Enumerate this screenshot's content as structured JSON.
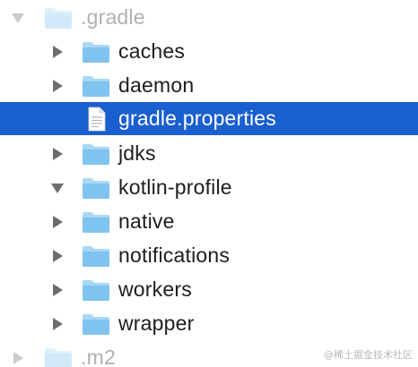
{
  "tree": {
    "items": [
      {
        "label": ".gradle",
        "type": "folder",
        "expanded": true,
        "faded": true
      },
      {
        "label": "caches",
        "type": "folder",
        "expanded": false
      },
      {
        "label": "daemon",
        "type": "folder",
        "expanded": false
      },
      {
        "label": "gradle.properties",
        "type": "file",
        "selected": true
      },
      {
        "label": "jdks",
        "type": "folder",
        "expanded": false
      },
      {
        "label": "kotlin-profile",
        "type": "folder",
        "expanded": true
      },
      {
        "label": "native",
        "type": "folder",
        "expanded": false
      },
      {
        "label": "notifications",
        "type": "folder",
        "expanded": false
      },
      {
        "label": "workers",
        "type": "folder",
        "expanded": false
      },
      {
        "label": "wrapper",
        "type": "folder",
        "expanded": false
      },
      {
        "label": ".m2",
        "type": "folder",
        "expanded": false,
        "faded": true
      }
    ]
  },
  "watermark": "@稀土掘金技术社区",
  "colors": {
    "selection": "#1a5fd0",
    "folder": "#7fc3ef",
    "disclosure": "#6e6e6e"
  }
}
